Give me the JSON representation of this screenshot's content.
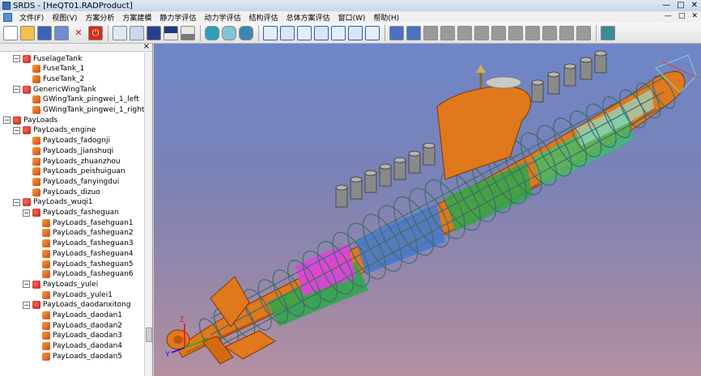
{
  "window": {
    "title": "SRDS - [HeQT01.RADProduct]",
    "controls": [
      "—",
      "□",
      "✕"
    ]
  },
  "menubar": {
    "items": [
      "文件(F)",
      "视图(V)",
      "方案分析",
      "方案建模",
      "静力学评估",
      "动力学评估",
      "结构评估",
      "总体方案评估",
      "窗口(W)",
      "帮助(H)"
    ],
    "mdi_controls": [
      "—",
      "□",
      "✕"
    ]
  },
  "toolbar": {
    "groups": [
      [
        "new-file-icon",
        "open-folder-icon",
        "save-icon",
        "save-as-icon",
        "delete-icon",
        "power-icon"
      ],
      [
        "view-fit-icon",
        "view-select-icon",
        "view-dark-icon",
        "view-top-icon",
        "view-window-icon"
      ],
      [
        "cylinder-icon",
        "cylinder-wire-icon",
        "cylinder-solid-icon"
      ],
      [
        "cube-front-icon",
        "cube-back-icon",
        "cube-left-icon",
        "cube-right-icon",
        "cube-top-icon",
        "cube-bottom-icon",
        "cube-iso-icon"
      ],
      [
        "export-icon",
        "import-icon",
        "doc-1-icon",
        "doc-2-icon",
        "doc-3-icon",
        "doc-4-icon",
        "doc-5-icon",
        "doc-6-icon",
        "doc-7-icon",
        "doc-8-icon",
        "doc-9-icon",
        "doc-10-icon"
      ],
      [
        "refresh-icon"
      ]
    ]
  },
  "panel": {
    "close_label": "×"
  },
  "tree": [
    {
      "label": "FuselageTank",
      "level": 2,
      "type": "group",
      "expander": "−"
    },
    {
      "label": "FuseTank_1",
      "level": 3,
      "type": "leaf"
    },
    {
      "label": "FuseTank_2",
      "level": 3,
      "type": "leaf"
    },
    {
      "label": "GenericWingTank",
      "level": 2,
      "type": "group",
      "expander": "−"
    },
    {
      "label": "GWingTank_pingwei_1_left",
      "level": 3,
      "type": "leaf"
    },
    {
      "label": "GWingTank_pingwei_1_right",
      "level": 3,
      "type": "leaf"
    },
    {
      "label": "PayLoads",
      "level": 1,
      "type": "group",
      "expander": "−"
    },
    {
      "label": "PayLoads_engine",
      "level": 2,
      "type": "group",
      "expander": "−"
    },
    {
      "label": "PayLoads_fadognji",
      "level": 3,
      "type": "leaf"
    },
    {
      "label": "PayLoads_jianshuqi",
      "level": 3,
      "type": "leaf"
    },
    {
      "label": "PayLoads_zhuanzhou",
      "level": 3,
      "type": "leaf"
    },
    {
      "label": "PayLoads_peishuiguan",
      "level": 3,
      "type": "leaf"
    },
    {
      "label": "PayLoads_fanyingdui",
      "level": 3,
      "type": "leaf"
    },
    {
      "label": "PayLoads_dizuo",
      "level": 3,
      "type": "leaf"
    },
    {
      "label": "PayLoads_wuqi1",
      "level": 2,
      "type": "group",
      "expander": "−"
    },
    {
      "label": "PayLoads_fasheguan",
      "level": 3,
      "type": "group",
      "expander": "−"
    },
    {
      "label": "PayLoads_fasehguan1",
      "level": 4,
      "type": "leaf"
    },
    {
      "label": "PayLoads_fasheguan2",
      "level": 4,
      "type": "leaf"
    },
    {
      "label": "PayLoads_fasheguan3",
      "level": 4,
      "type": "leaf"
    },
    {
      "label": "PayLoads_fasheguan4",
      "level": 4,
      "type": "leaf"
    },
    {
      "label": "PayLoads_fasheguan5",
      "level": 4,
      "type": "leaf"
    },
    {
      "label": "PayLoads_fasheguan6",
      "level": 4,
      "type": "leaf"
    },
    {
      "label": "PayLoads_yulei",
      "level": 3,
      "type": "group",
      "expander": "−"
    },
    {
      "label": "PayLoads_yulei1",
      "level": 4,
      "type": "leaf"
    },
    {
      "label": "PayLoads_daodanxitong",
      "level": 3,
      "type": "group",
      "expander": "−"
    },
    {
      "label": "PayLoads_daodan1",
      "level": 4,
      "type": "leaf"
    },
    {
      "label": "PayLoads_daodan2",
      "level": 4,
      "type": "leaf"
    },
    {
      "label": "PayLoads_daodan3",
      "level": 4,
      "type": "leaf"
    },
    {
      "label": "PayLoads_daodan4",
      "level": 4,
      "type": "leaf"
    },
    {
      "label": "PayLoads_daodan5",
      "level": 4,
      "type": "leaf"
    }
  ],
  "viewport": {
    "axis_labels": [
      "Z",
      "X",
      "Y"
    ],
    "colors": {
      "hull": "#e0781c",
      "frame": "#3f6b6e",
      "section_green": "#2aa84a",
      "section_blue": "#3d7ad8",
      "section_magenta": "#e040e0",
      "mast": "#8a8a8a"
    }
  }
}
